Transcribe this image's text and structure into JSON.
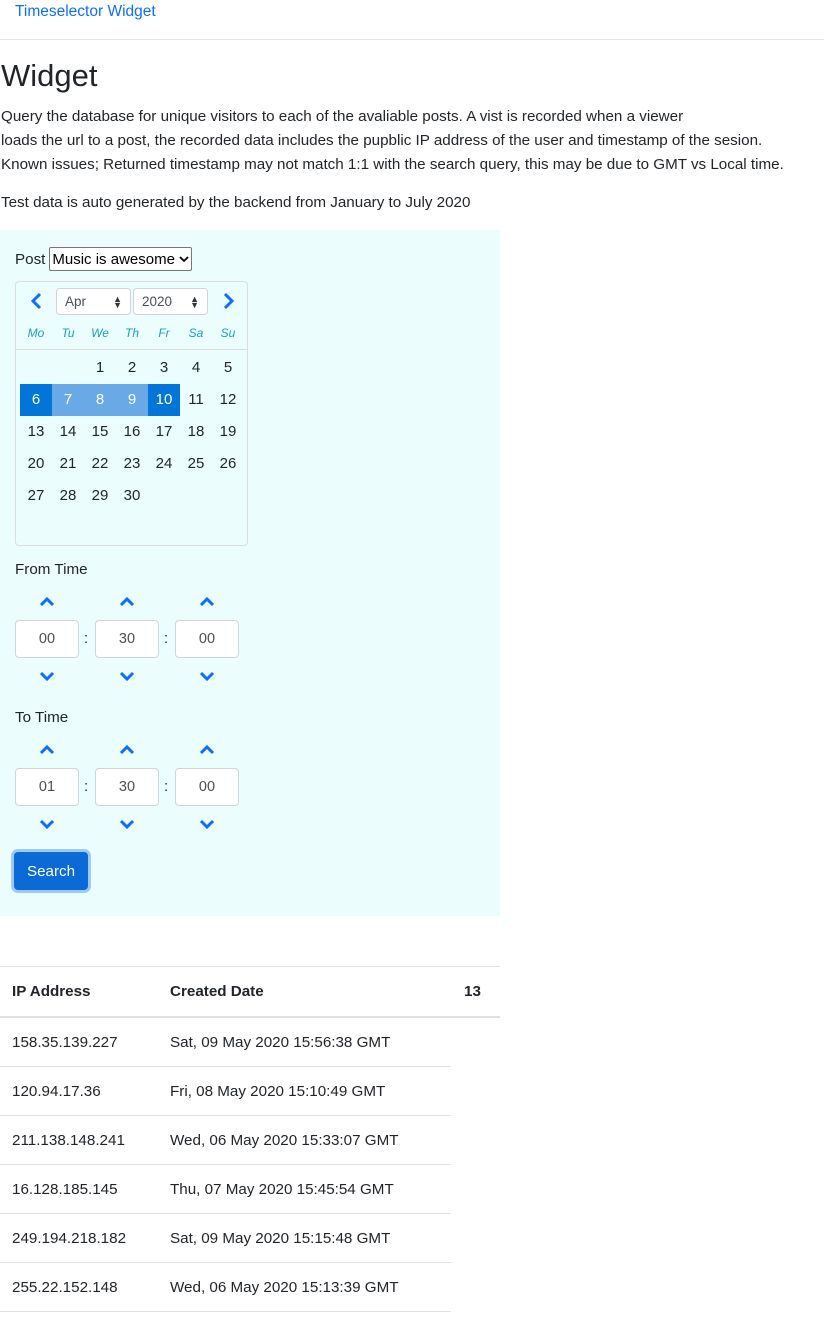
{
  "nav": {
    "brand": "Timeselector Widget"
  },
  "page": {
    "title": "Widget",
    "description_lines": [
      "Query the database for unique visitors to each of the avaliable posts. A vist is recorded when a viewer",
      "loads the url to a post, the recorded data includes the pupblic IP address of the user and timestamp of the sesion.",
      "Known issues; Returned timestamp may not match 1:1 with the search query, this may be due to GMT vs Local time."
    ],
    "note": "Test data is auto generated by the backend from January to July 2020"
  },
  "form": {
    "post_label": "Post",
    "post_selected": "Music is awesome",
    "calendar": {
      "month": "Apr",
      "year": "2020",
      "weekdays": [
        "Mo",
        "Tu",
        "We",
        "Th",
        "Fr",
        "Sa",
        "Su"
      ],
      "weeks": [
        [
          "",
          "",
          "1",
          "2",
          "3",
          "4",
          "5"
        ],
        [
          "6",
          "7",
          "8",
          "9",
          "10",
          "11",
          "12"
        ],
        [
          "13",
          "14",
          "15",
          "16",
          "17",
          "18",
          "19"
        ],
        [
          "20",
          "21",
          "22",
          "23",
          "24",
          "25",
          "26"
        ],
        [
          "27",
          "28",
          "29",
          "30",
          "",
          "",
          ""
        ]
      ],
      "range_start": "6",
      "range_end": "10",
      "range_middle": [
        "7",
        "8",
        "9"
      ]
    },
    "from_time": {
      "label": "From Time",
      "hours": "00",
      "minutes": "30",
      "seconds": "00",
      "separator": ":"
    },
    "to_time": {
      "label": "To Time",
      "hours": "01",
      "minutes": "30",
      "seconds": "00",
      "separator": ":"
    },
    "search_label": "Search"
  },
  "results": {
    "headers": {
      "ip": "IP Address",
      "date": "Created Date",
      "count": "13"
    },
    "rows": [
      {
        "ip": "158.35.139.227",
        "date": "Sat, 09 May 2020 15:56:38 GMT"
      },
      {
        "ip": "120.94.17.36",
        "date": "Fri, 08 May 2020 15:10:49 GMT"
      },
      {
        "ip": "211.138.148.241",
        "date": "Wed, 06 May 2020 15:33:07 GMT"
      },
      {
        "ip": "16.128.185.145",
        "date": "Thu, 07 May 2020 15:45:54 GMT"
      },
      {
        "ip": "249.194.218.182",
        "date": "Sat, 09 May 2020 15:15:48 GMT"
      },
      {
        "ip": "255.22.152.148",
        "date": "Wed, 06 May 2020 15:13:39 GMT"
      }
    ]
  },
  "colors": {
    "accent": "#0d6efd",
    "panel": "#ebfdfd",
    "range_end": "#0275d8",
    "range_mid": "#69aae6"
  },
  "icons": {
    "prev": "chevron-left-icon",
    "next": "chevron-right-icon",
    "up": "chevron-up-icon",
    "down": "chevron-down-icon"
  }
}
